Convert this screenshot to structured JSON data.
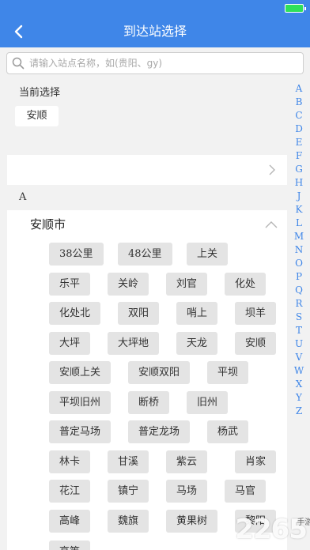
{
  "header": {
    "title": "到达站选择"
  },
  "search": {
    "placeholder": "请输入站点名称，如(贵阳、gy)"
  },
  "current": {
    "label": "当前选择",
    "value": "安顺"
  },
  "group": {
    "letter": "A",
    "city": "安顺市"
  },
  "stations": [
    "38公里",
    "48公里",
    "上关",
    "乐平",
    "关岭",
    "刘官",
    "化处",
    "化处北",
    "双阳",
    "哨上",
    "坝羊",
    "大坪",
    "大坪地",
    "天龙",
    "安顺",
    "安顺上关",
    "安顺双阳",
    "平坝",
    "平坝旧州",
    "断桥",
    "旧州",
    "普定马场",
    "普定龙场",
    "杨武",
    "林卡",
    "甘溪",
    "紫云",
    "肖家",
    "花江",
    "镇宁",
    "马场",
    "马官",
    "高峰",
    "魏旗",
    "黄果树",
    "黎阳",
    "高等"
  ],
  "index_letters": [
    "A",
    "B",
    "C",
    "D",
    "E",
    "F",
    "G",
    "H",
    "J",
    "K",
    "L",
    "M",
    "N",
    "O",
    "P",
    "Q",
    "R",
    "S",
    "T",
    "U",
    "V",
    "W",
    "X",
    "Y",
    "Z"
  ],
  "watermark": {
    "text": "2265",
    "sub": "手游网"
  },
  "colors": {
    "accent": "#3f86e8",
    "chip_bg": "#e4e4e4",
    "battery": "#2ee05a"
  },
  "icons": {
    "back": "chevron-left-icon",
    "search": "search-icon",
    "expand": "chevron-right-icon",
    "collapse": "chevron-up-icon"
  }
}
